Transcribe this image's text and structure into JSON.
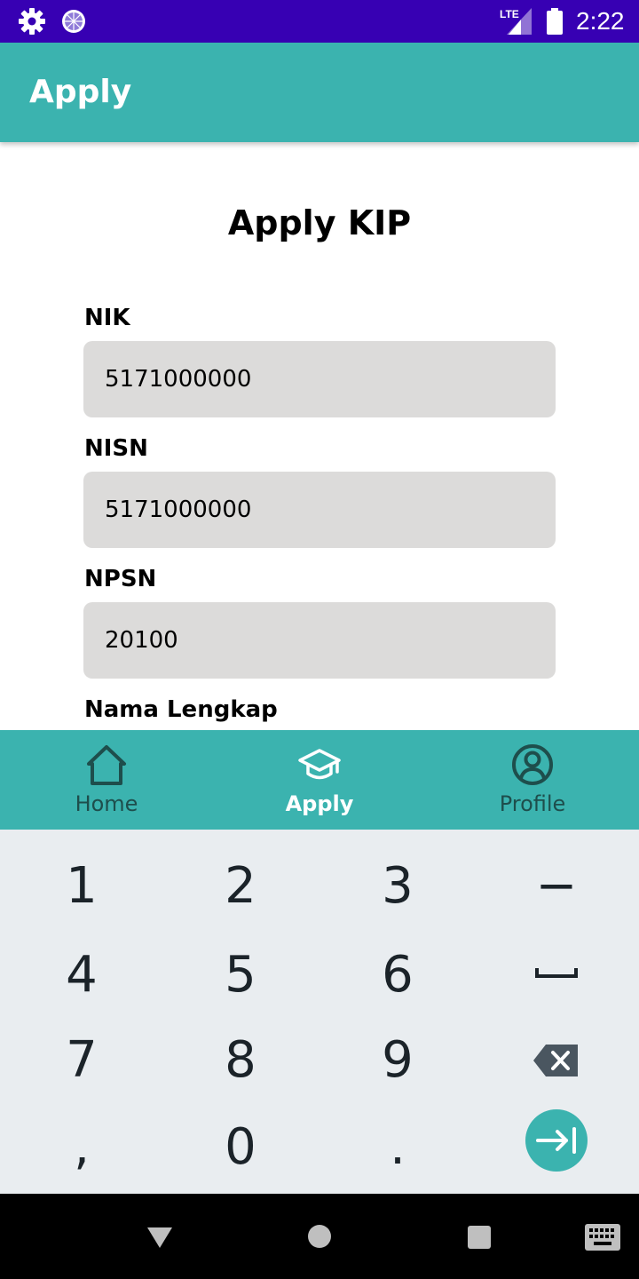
{
  "status_bar": {
    "time": "2:22",
    "network_label": "LTE",
    "icons": [
      "settings-gear-icon",
      "loading-circle-icon",
      "signal-icon",
      "battery-icon"
    ]
  },
  "app_bar": {
    "title": "Apply"
  },
  "form": {
    "title": "Apply KIP",
    "fields": [
      {
        "label": "NIK",
        "value": "5171000000"
      },
      {
        "label": "NISN",
        "value": "5171000000"
      },
      {
        "label": "NPSN",
        "value": "20100"
      },
      {
        "label": "Nama Lengkap",
        "value": ""
      }
    ]
  },
  "bottom_nav": {
    "items": [
      {
        "label": "Home",
        "icon": "home-icon",
        "active": false
      },
      {
        "label": "Apply",
        "icon": "graduation-cap-icon",
        "active": true
      },
      {
        "label": "Profile",
        "icon": "profile-icon",
        "active": false
      }
    ]
  },
  "keyboard": {
    "keys": [
      "1",
      "2",
      "3",
      "−",
      "4",
      "5",
      "6",
      "7",
      "8",
      "9",
      ",",
      "0",
      "."
    ],
    "special": [
      "space-key-icon",
      "backspace-icon",
      "next-arrow-icon"
    ]
  },
  "colors": {
    "status_bar": "#3700b3",
    "primary": "#3bb3af",
    "input_bg": "#dcdbda",
    "keyboard_bg": "#e9edf0",
    "nav_inactive": "#1e4e4c"
  },
  "system_nav": {
    "icons": [
      "back-triangle-icon",
      "home-circle-icon",
      "recents-square-icon",
      "keyboard-switch-icon"
    ]
  }
}
